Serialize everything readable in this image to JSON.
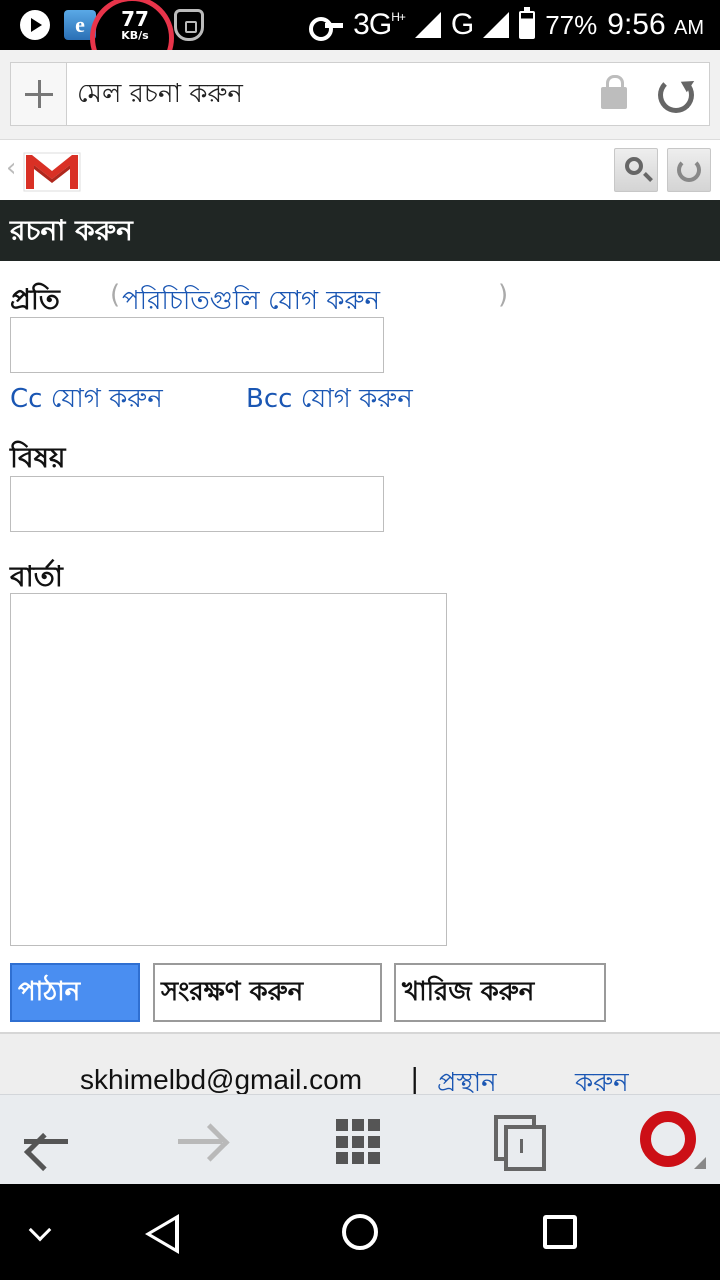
{
  "status_bar": {
    "speed_value": "77",
    "speed_unit": "KB/s",
    "network": "3G",
    "network_sup": "H+",
    "network2": "G",
    "battery_percent": "77%",
    "time": "9:56",
    "ampm": "AM"
  },
  "browser": {
    "url_text": "মেল রচনা করুন"
  },
  "page": {
    "title": "রচনা   করুন",
    "to_label": "প্রতি",
    "add_contacts_open": "(",
    "add_contacts_link": "পরিচিতিগুলি যোগ করুন",
    "add_contacts_close": ")",
    "add_cc": "Cc যোগ করুন",
    "add_bcc": "Bcc যোগ করুন",
    "subject_label": "বিষয়",
    "message_label": "বার্তা",
    "to_value": "",
    "subject_value": "",
    "message_value": "",
    "send_button": "পাঠান",
    "save_button": "সংরক্ষণ করুন",
    "discard_button": "খারিজ করুন"
  },
  "footer": {
    "account_email": "skhimelbd@gmail.com",
    "separator": "|",
    "signout_word1": "প্রস্থান",
    "signout_word2": "করুন"
  },
  "colors": {
    "link": "#1a56b3",
    "title_bar": "#202624",
    "send_button": "#4a8ef1",
    "speed_highlight": "#e8344a",
    "opera_red": "#cc0f16"
  },
  "icons": [
    "play-icon",
    "browser-app-icon",
    "shield-icon",
    "key-icon",
    "signal-icon",
    "battery-icon",
    "new-tab-plus-icon",
    "lock-icon",
    "reload-icon",
    "gmail-logo",
    "search-icon",
    "refresh-icon",
    "back-arrow-icon",
    "forward-arrow-icon",
    "speed-dial-icon",
    "tabs-icon",
    "opera-logo",
    "nav-collapse-icon",
    "nav-back-icon",
    "nav-home-icon",
    "nav-recents-icon"
  ]
}
